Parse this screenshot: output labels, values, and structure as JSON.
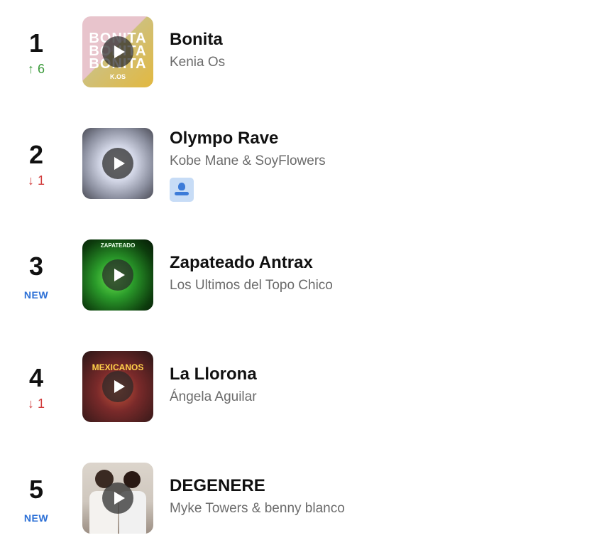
{
  "chart": {
    "entries": [
      {
        "rank": "1",
        "change": "↑ 6",
        "change_type": "up",
        "title": "Bonita",
        "artist": "Kenia Os",
        "cover_text": "BONITA",
        "cover_label": "K.OS"
      },
      {
        "rank": "2",
        "change": "↓ 1",
        "change_type": "down",
        "title": "Olympo Rave",
        "artist": "Kobe Mane & SoyFlowers",
        "badge_icon": "artist-portrait-icon"
      },
      {
        "rank": "3",
        "change": "NEW",
        "change_type": "new",
        "title": "Zapateado Antrax",
        "artist": "Los Ultimos del Topo Chico",
        "cover_text": "ZAPATEADO"
      },
      {
        "rank": "4",
        "change": "↓ 1",
        "change_type": "down",
        "title": "La Llorona",
        "artist": "Ángela Aguilar",
        "cover_text": "MEXICANOS"
      },
      {
        "rank": "5",
        "change": "NEW",
        "change_type": "new",
        "title": "DEGENERE",
        "artist": "Myke Towers & benny blanco"
      }
    ]
  },
  "colors": {
    "up": "#3a9a3a",
    "down": "#d13b3b",
    "new": "#2b6fd6",
    "badge_bg": "#c7dcf6",
    "badge_icon": "#3c7bd8"
  }
}
